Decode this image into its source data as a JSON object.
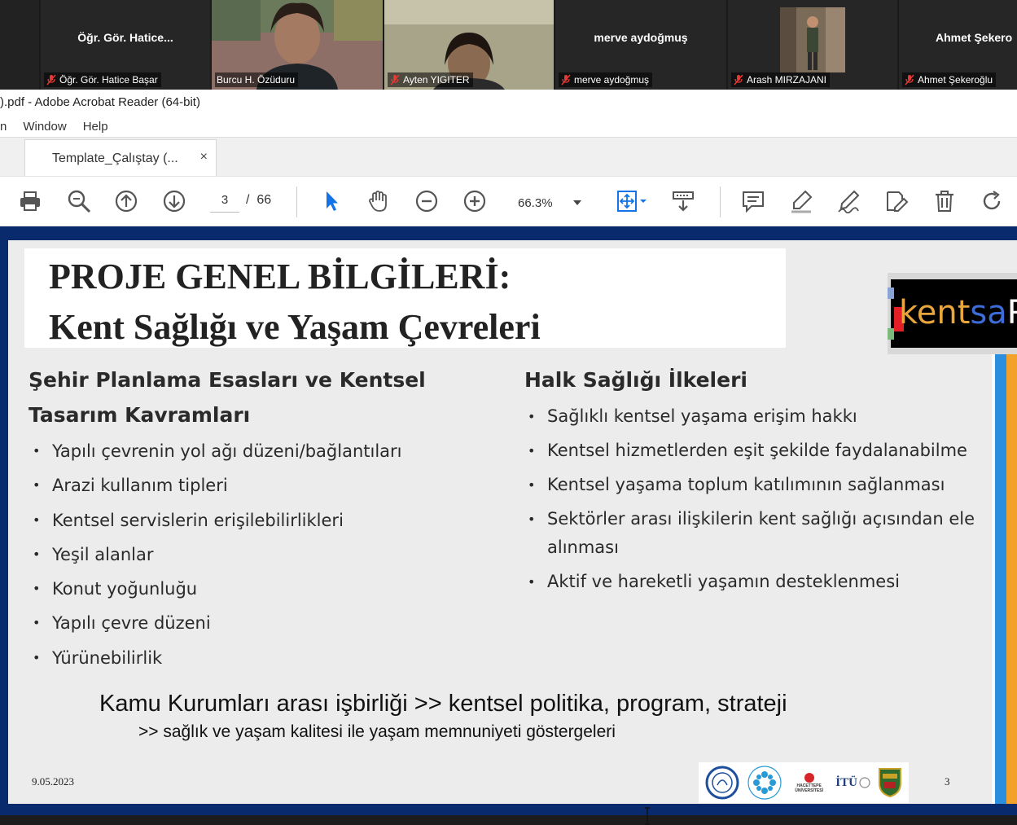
{
  "meeting": {
    "participants": [
      {
        "display": "Öğr. Gör. Hatice...",
        "caption": "Öğr. Gör. Hatice Başar",
        "video": false
      },
      {
        "display": "",
        "caption": "Burcu H. Özüduru",
        "video": true
      },
      {
        "display": "",
        "caption": "Ayten YIGITER",
        "video": true
      },
      {
        "display": "merve aydoğmuş",
        "caption": "merve aydoğmuş",
        "video": false
      },
      {
        "display": "",
        "caption": "Arash MIRZAJANI",
        "video": true
      },
      {
        "display": "Ahmet Şekero",
        "caption": "Ahmet Şekeroğlu",
        "video": false
      }
    ]
  },
  "window": {
    "title": ").pdf - Adobe Acrobat Reader (64-bit)",
    "menu": [
      "n",
      "Window",
      "Help"
    ]
  },
  "tab": {
    "label": "Template_Çalıştay (...",
    "close": "×"
  },
  "toolbar": {
    "page_current": "3",
    "page_sep": "/",
    "page_total": "66",
    "zoom": "66.3%"
  },
  "slide": {
    "title_line1": "PROJE GENEL BİLGİLERİ:",
    "title_line2": "Kent Sağlığı ve Yaşam Çevreleri",
    "logo_word": {
      "a": "kent",
      "b": "sa",
      "c": "P"
    },
    "left_heading": "Şehir Planlama Esasları ve Kentsel Tasarım Kavramları",
    "left_items": [
      "Yapılı çevrenin yol ağı düzeni/bağlantıları",
      "Arazi kullanım tipleri",
      "Kentsel servislerin erişilebilirlikleri",
      "Yeşil alanlar",
      "Konut yoğunluğu",
      "Yapılı çevre düzeni",
      "Yürünebilirlik"
    ],
    "right_heading": "Halk Sağlığı İlkeleri",
    "right_items": [
      "Sağlıklı kentsel yaşama erişim hakkı",
      "Kentsel hizmetlerden eşit şekilde faydalanabilme",
      "Kentsel yaşama toplum katılımının sağlanması",
      "Sektörler arası ilişkilerin kent sağlığı açısından ele alınması",
      "Aktif ve hareketli yaşamın desteklenmesi"
    ],
    "footer_main": "Kamu Kurumları arası işbirliği >> kentsel politika, program, strateji",
    "footer_sub": ">> sağlık ve yaşam kalitesi ile yaşam memnuniyeti göstergeleri",
    "date": "9.05.2023",
    "page_number": "3",
    "logo_text": {
      "hacettepe": "HACETTEPE ÜNİVERSİTESİ",
      "itu": "İTÜ"
    }
  },
  "colors": {
    "doc_background": "#0a2a6e",
    "slide_background": "#ececec",
    "accent_blue": "#2b8ede",
    "accent_orange": "#f2a22a",
    "active_speaker": "#8bc34a",
    "mute_red": "#e53935"
  }
}
